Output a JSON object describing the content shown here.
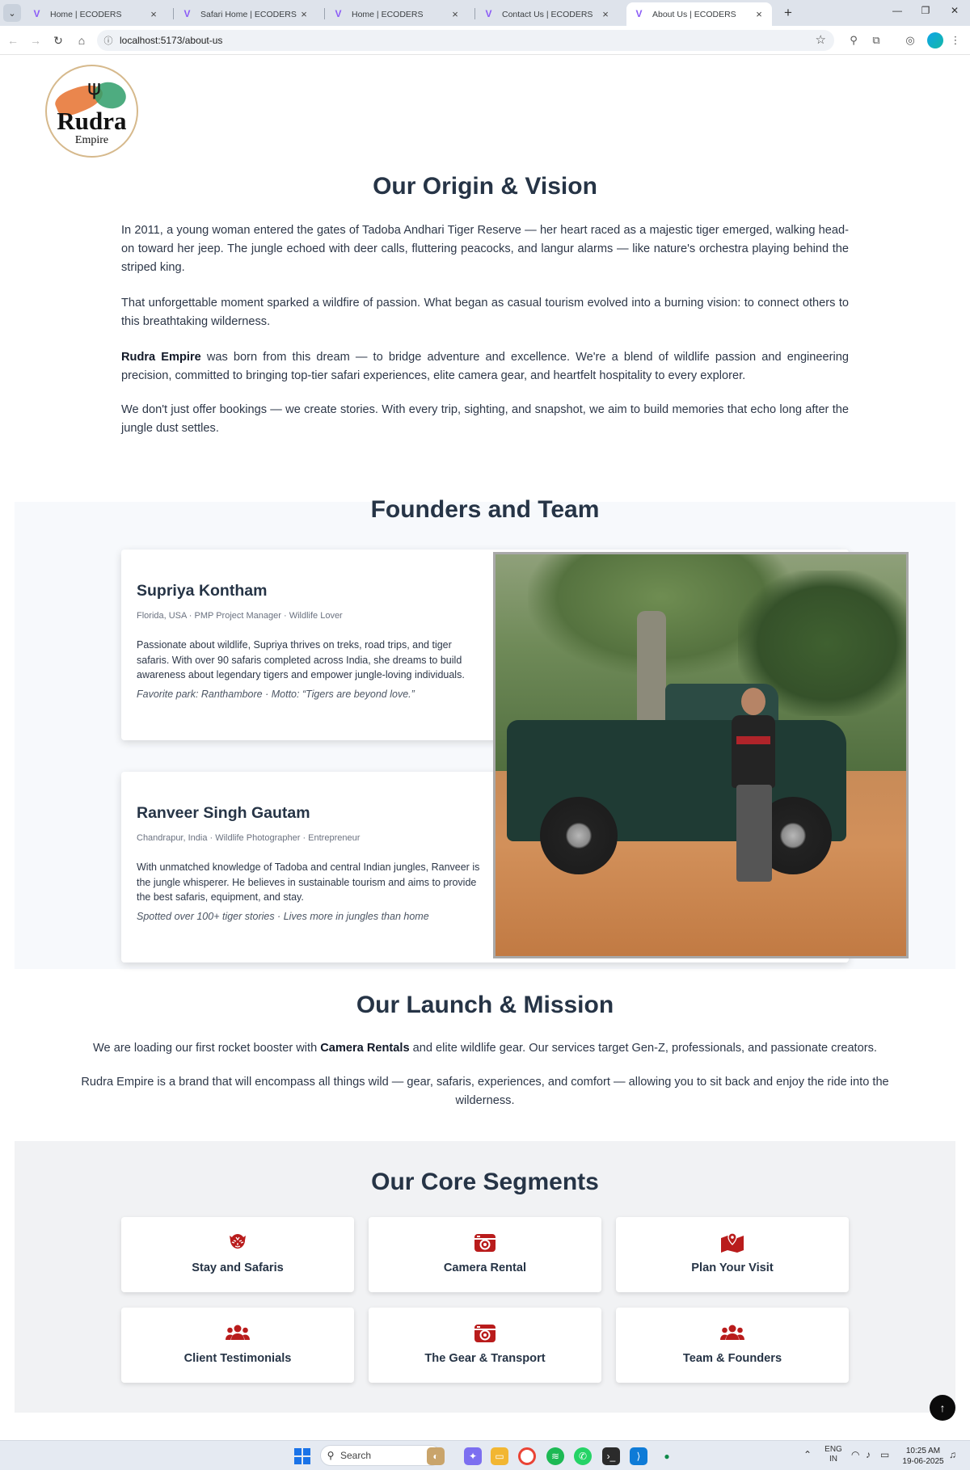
{
  "browser": {
    "tabs": [
      {
        "title": "Home | ECODERS",
        "active": false
      },
      {
        "title": "Safari Home | ECODERS",
        "active": false
      },
      {
        "title": "Home | ECODERS",
        "active": false
      },
      {
        "title": "Contact Us | ECODERS",
        "active": false
      },
      {
        "title": "About Us | ECODERS",
        "active": true
      }
    ],
    "url": "localhost:5173/about-us"
  },
  "logo": {
    "word": "Rudra",
    "subword": "Empire"
  },
  "origin": {
    "title": "Our Origin & Vision",
    "p1": "In 2011, a young woman entered the gates of Tadoba Andhari Tiger Reserve — her heart raced as a majestic tiger emerged, walking head-on toward her jeep. The jungle echoed with deer calls, fluttering peacocks, and langur alarms — like nature's orchestra playing behind the striped king.",
    "p2": "That unforgettable moment sparked a wildfire of passion. What began as casual tourism evolved into a burning vision: to connect others to this breathtaking wilderness.",
    "p3_bold": "Rudra Empire",
    "p3_rest": " was born from this dream — to bridge adventure and excellence. We're a blend of wildlife passion and engineering precision, committed to bringing top-tier safari experiences, elite camera gear, and heartfelt hospitality to every explorer.",
    "p4": "We don't just offer bookings — we create stories. With every trip, sighting, and snapshot, we aim to build memories that echo long after the jungle dust settles."
  },
  "founders": {
    "title": "Founders and Team",
    "people": [
      {
        "name": "Supriya Kontham",
        "meta": "Florida, USA · PMP Project Manager · Wildlife Lover",
        "bio": "Passionate about wildlife, Supriya thrives on treks, road trips, and tiger safaris. With over 90 safaris completed across India, she dreams to build awareness about legendary tigers and empower jungle-loving individuals.",
        "fav": "Favorite park: Ranthambore · Motto: “Tigers are beyond love.”"
      },
      {
        "name": "Ranveer Singh Gautam",
        "meta": "Chandrapur, India · Wildlife Photographer · Entrepreneur",
        "bio": "With unmatched knowledge of Tadoba and central Indian jungles, Ranveer is the jungle whisperer. He believes in sustainable tourism and aims to provide the best safaris, equipment, and stay.",
        "fav": "Spotted over 100+ tiger stories · Lives more in jungles than home"
      }
    ]
  },
  "launch": {
    "title": "Our Launch & Mission",
    "p1_pre": "We are loading our first rocket booster with ",
    "p1_bold": "Camera Rentals",
    "p1_post": " and elite wildlife gear. Our services target Gen-Z, professionals, and passionate creators.",
    "p2": "Rudra Empire is a brand that will encompass all things wild — gear, safaris, experiences, and comfort — allowing you to sit back and enjoy the ride into the wilderness."
  },
  "segments": {
    "title": "Our Core Segments",
    "accent": "#b91c1c",
    "items": [
      {
        "label": "Stay and Safaris",
        "icon": "tiger-icon"
      },
      {
        "label": "Camera Rental",
        "icon": "camera-icon"
      },
      {
        "label": "Plan Your Visit",
        "icon": "map-pin-icon"
      },
      {
        "label": "Client Testimonials",
        "icon": "users-icon"
      },
      {
        "label": "The Gear & Transport",
        "icon": "camera-icon"
      },
      {
        "label": "Team & Founders",
        "icon": "users-icon"
      }
    ]
  },
  "taskbar": {
    "search": "Search",
    "lang_top": "ENG",
    "lang_bottom": "IN",
    "time": "10:25 AM",
    "date": "19-06-2025"
  }
}
